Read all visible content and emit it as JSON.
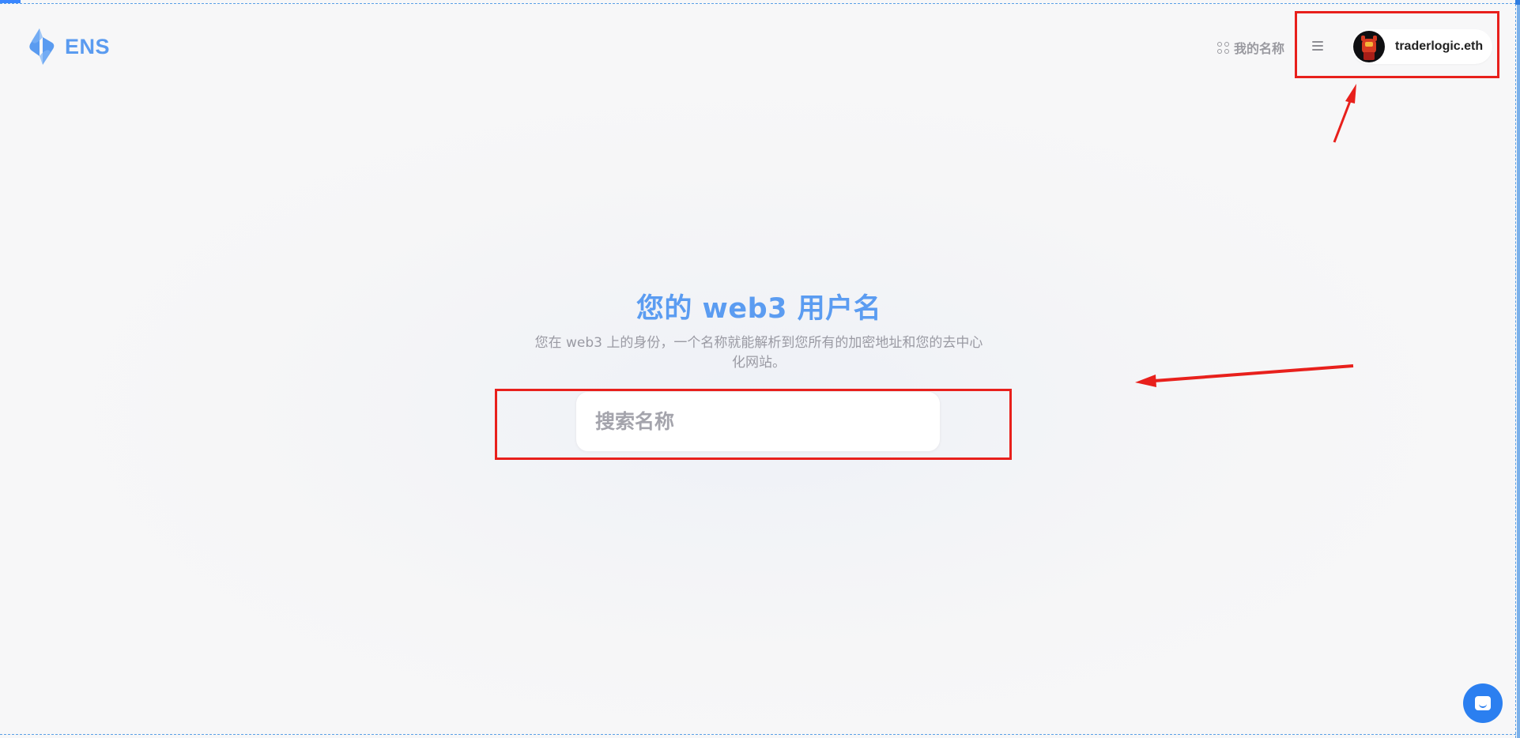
{
  "header": {
    "logo_text": "ENS",
    "my_names_label": "我的名称",
    "profile_name": "traderlogic.eth"
  },
  "hero": {
    "title": "您的 web3 用户名",
    "subtitle": "您在 web3 上的身份，一个名称就能解析到您所有的加密地址和您的去中心化网站。"
  },
  "search": {
    "placeholder": "搜索名称",
    "value": ""
  },
  "colors": {
    "accent": "#5b9cf1",
    "annotation": "#e8201c",
    "chat": "#2b7ff0"
  },
  "icons": [
    "ens-logo-icon",
    "grid-icon",
    "menu-icon",
    "avatar",
    "chat-icon"
  ]
}
